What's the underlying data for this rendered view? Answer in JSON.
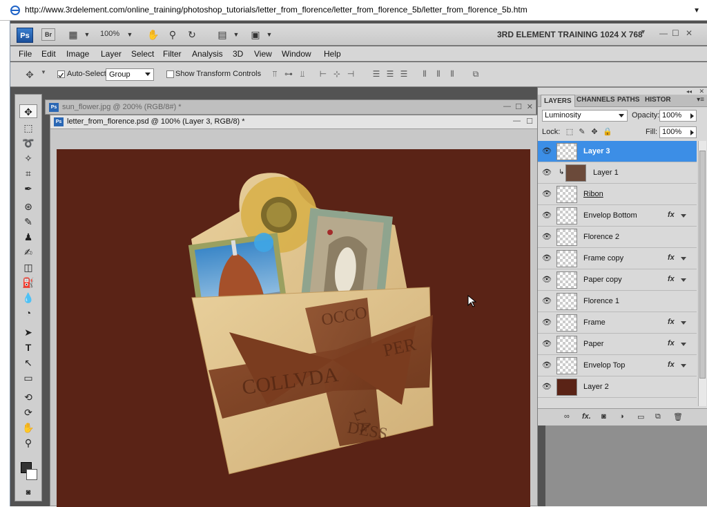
{
  "browser": {
    "url": "http://www.3rdelement.com/online_training/photoshop_tutorials/letter_from_florence/letter_from_florence_5b/letter_from_florence_5b.htm"
  },
  "appbar": {
    "ps_logo": "Ps",
    "br_logo": "Br",
    "zoom": "100%",
    "workspace": "3RD ELEMENT TRAINING 1024 X 768"
  },
  "menu": [
    "File",
    "Edit",
    "Image",
    "Layer",
    "Select",
    "Filter",
    "Analysis",
    "3D",
    "View",
    "Window",
    "Help"
  ],
  "options": {
    "auto_select_label": "Auto-Select:",
    "auto_select_value": "Group",
    "show_transform_label": "Show Transform Controls"
  },
  "documents": {
    "back_title": "sun_flower.jpg @ 200% (RGB/8#) *",
    "front_title": "letter_from_florence.psd @ 100% (Layer 3, RGB/8) *"
  },
  "panel": {
    "tabs": [
      "LAYERS",
      "CHANNELS",
      "PATHS",
      "HISTOR"
    ],
    "blend_mode": "Luminosity",
    "opacity_label": "Opacity:",
    "opacity_value": "100%",
    "lock_label": "Lock:",
    "fill_label": "Fill:",
    "fill_value": "100%",
    "layers": [
      {
        "name": "Layer 3",
        "fx": "",
        "selected": true
      },
      {
        "name": "Layer 1",
        "fx": ""
      },
      {
        "name": "Ribon",
        "fx": ""
      },
      {
        "name": "Envelop Bottom",
        "fx": "fx"
      },
      {
        "name": "Florence 2",
        "fx": ""
      },
      {
        "name": "Frame copy",
        "fx": "fx"
      },
      {
        "name": "Paper copy",
        "fx": "fx"
      },
      {
        "name": "Florence 1",
        "fx": ""
      },
      {
        "name": "Frame",
        "fx": "fx"
      },
      {
        "name": "Paper",
        "fx": "fx"
      },
      {
        "name": "Envelop Top",
        "fx": "fx"
      },
      {
        "name": "Layer 2",
        "fx": ""
      }
    ]
  },
  "artwork": {
    "ribbon_text": [
      "OCCO",
      "COLLVDA",
      "PER",
      "LA",
      "DESS"
    ]
  },
  "colors": {
    "canvas": "#5a2316",
    "selection": "#3c8ee6"
  }
}
